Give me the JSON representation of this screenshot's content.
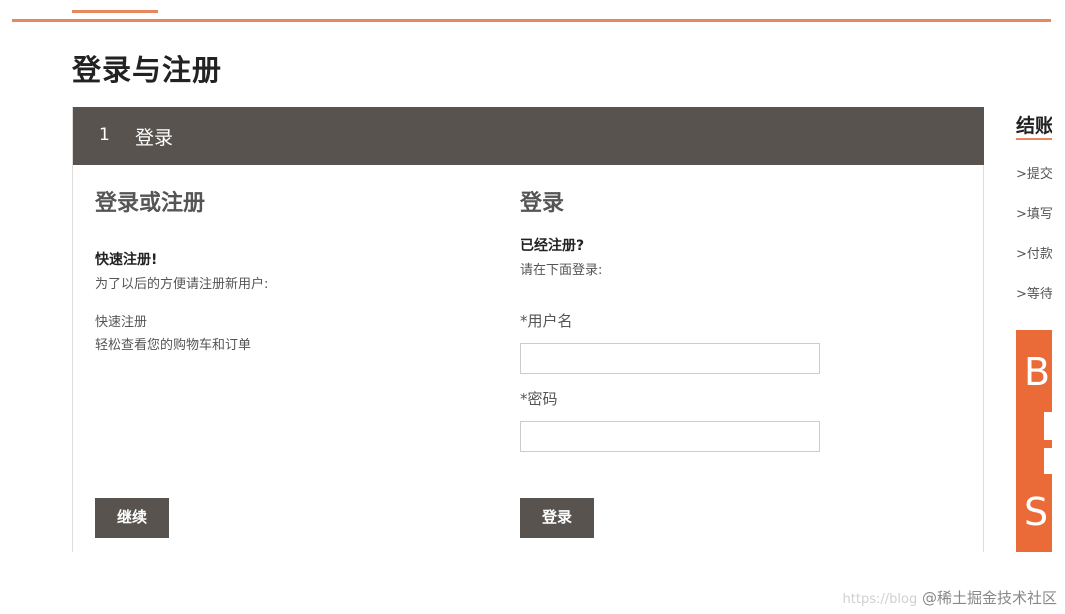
{
  "page": {
    "title": "登录与注册"
  },
  "step": {
    "number": "1",
    "title": "登录"
  },
  "register": {
    "heading": "登录或注册",
    "quick_title": "快速注册!",
    "quick_desc": "为了以后的方便请注册新用户:",
    "benefit_title": "快速注册",
    "benefit_desc": "轻松查看您的购物车和订单",
    "continue_label": "继续"
  },
  "login": {
    "heading": "登录",
    "registered_title": "已经注册?",
    "registered_desc": "请在下面登录:",
    "username_label": "*用户名",
    "username_value": "",
    "password_label": "*密码",
    "password_value": "",
    "submit_label": "登录"
  },
  "sidebar": {
    "title": "结账",
    "items": [
      ">提交",
      ">填写",
      ">付款",
      ">等待"
    ]
  },
  "banner": {
    "letters": [
      "B",
      "S"
    ]
  },
  "watermark": {
    "url": "https://blog",
    "brand": "@稀土掘金技术社区"
  },
  "colors": {
    "accent": "#e8865e",
    "header_bg": "#58534e",
    "banner_bg": "#ea6a38"
  }
}
